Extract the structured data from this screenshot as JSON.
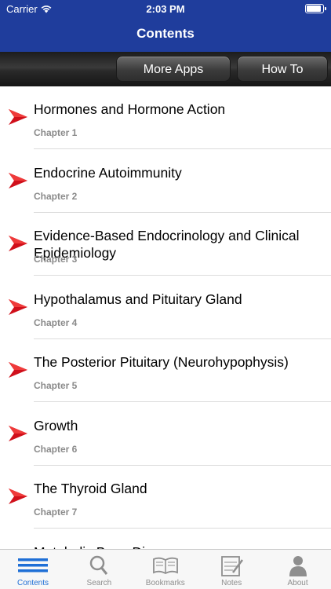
{
  "status": {
    "carrier": "Carrier",
    "time": "2:03 PM",
    "battery_level": 1.0
  },
  "nav": {
    "title": "Contents"
  },
  "toolbar": {
    "more_apps": "More Apps",
    "how_to": "How To"
  },
  "chapters": [
    {
      "title": "Hormones and Hormone Action",
      "sub": "Chapter 1"
    },
    {
      "title": "Endocrine Autoimmunity",
      "sub": "Chapter 2"
    },
    {
      "title": "Evidence-Based Endocrinology and Clinical Epidemiology",
      "sub": "Chapter 3"
    },
    {
      "title": "Hypothalamus and Pituitary Gland",
      "sub": "Chapter 4"
    },
    {
      "title": "The Posterior Pituitary (Neurohypophysis)",
      "sub": "Chapter 5"
    },
    {
      "title": "Growth",
      "sub": "Chapter 6"
    },
    {
      "title": "The Thyroid Gland",
      "sub": "Chapter 7"
    },
    {
      "title": "Metabolic Bone Disease",
      "sub": ""
    }
  ],
  "tabs": [
    {
      "label": "Contents",
      "icon": "list-icon",
      "active": true
    },
    {
      "label": "Search",
      "icon": "search-icon",
      "active": false
    },
    {
      "label": "Bookmarks",
      "icon": "book-icon",
      "active": false
    },
    {
      "label": "Notes",
      "icon": "notes-icon",
      "active": false
    },
    {
      "label": "About",
      "icon": "person-icon",
      "active": false
    }
  ],
  "colors": {
    "nav_bar": "#1f3d9c",
    "arrow_red": "#d0101b",
    "tab_active": "#1f6fd6",
    "tab_inactive": "#8e8e8e"
  }
}
